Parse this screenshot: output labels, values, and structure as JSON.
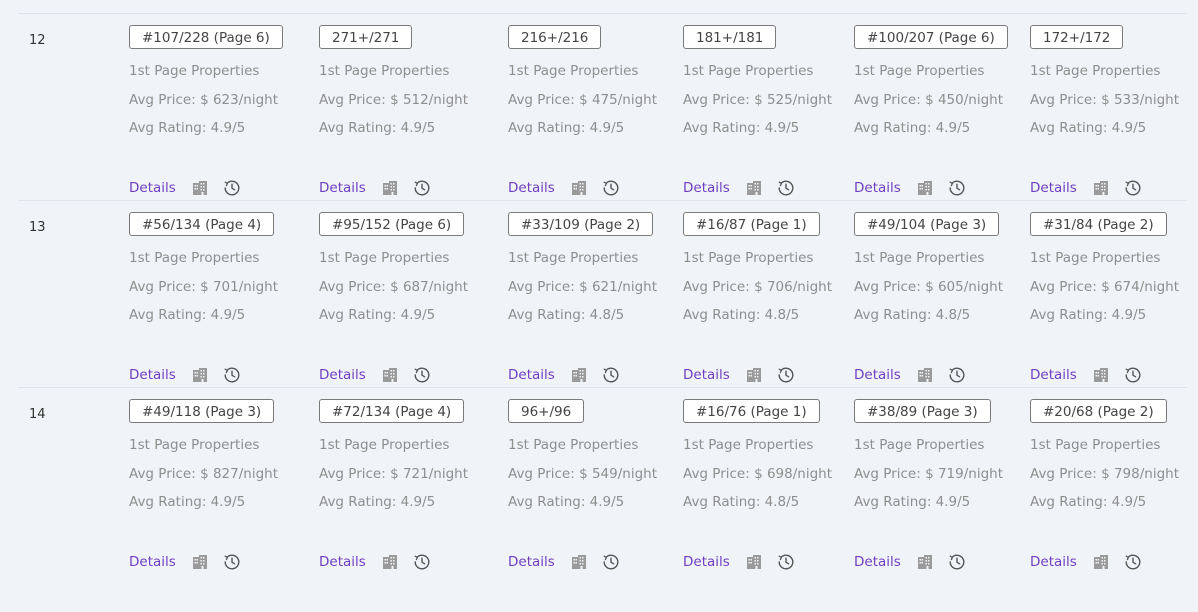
{
  "colors": {
    "link": "#6f3fc1",
    "muted": "#8e8e8e",
    "background": "#f0f4f8"
  },
  "icons": {
    "building": "building-icon",
    "history": "history-icon"
  },
  "rows": [
    {
      "number": "12",
      "cells": [
        {
          "rank": "#107/228 (Page 6)",
          "label": "1st Page Properties",
          "price": "Avg Price: $ 623/night",
          "rating": "Avg Rating: 4.9/5",
          "details": "Details"
        },
        {
          "rank": "271+/271",
          "label": "1st Page Properties",
          "price": "Avg Price: $ 512/night",
          "rating": "Avg Rating: 4.9/5",
          "details": "Details"
        },
        {
          "rank": "216+/216",
          "label": "1st Page Properties",
          "price": "Avg Price: $ 475/night",
          "rating": "Avg Rating: 4.9/5",
          "details": "Details"
        },
        {
          "rank": "181+/181",
          "label": "1st Page Properties",
          "price": "Avg Price: $ 525/night",
          "rating": "Avg Rating: 4.9/5",
          "details": "Details"
        },
        {
          "rank": "#100/207 (Page 6)",
          "label": "1st Page Properties",
          "price": "Avg Price: $ 450/night",
          "rating": "Avg Rating: 4.9/5",
          "details": "Details"
        },
        {
          "rank": "172+/172",
          "label": "1st Page Properties",
          "price": "Avg Price: $ 533/night",
          "rating": "Avg Rating: 4.9/5",
          "details": "Details"
        }
      ]
    },
    {
      "number": "13",
      "cells": [
        {
          "rank": "#56/134 (Page 4)",
          "label": "1st Page Properties",
          "price": "Avg Price: $ 701/night",
          "rating": "Avg Rating: 4.9/5",
          "details": "Details"
        },
        {
          "rank": "#95/152 (Page 6)",
          "label": "1st Page Properties",
          "price": "Avg Price: $ 687/night",
          "rating": "Avg Rating: 4.9/5",
          "details": "Details"
        },
        {
          "rank": "#33/109 (Page 2)",
          "label": "1st Page Properties",
          "price": "Avg Price: $ 621/night",
          "rating": "Avg Rating: 4.8/5",
          "details": "Details"
        },
        {
          "rank": "#16/87 (Page 1)",
          "label": "1st Page Properties",
          "price": "Avg Price: $ 706/night",
          "rating": "Avg Rating: 4.8/5",
          "details": "Details"
        },
        {
          "rank": "#49/104 (Page 3)",
          "label": "1st Page Properties",
          "price": "Avg Price: $ 605/night",
          "rating": "Avg Rating: 4.8/5",
          "details": "Details"
        },
        {
          "rank": "#31/84 (Page 2)",
          "label": "1st Page Properties",
          "price": "Avg Price: $ 674/night",
          "rating": "Avg Rating: 4.9/5",
          "details": "Details"
        }
      ]
    },
    {
      "number": "14",
      "cells": [
        {
          "rank": "#49/118 (Page 3)",
          "label": "1st Page Properties",
          "price": "Avg Price: $ 827/night",
          "rating": "Avg Rating: 4.9/5",
          "details": "Details"
        },
        {
          "rank": "#72/134 (Page 4)",
          "label": "1st Page Properties",
          "price": "Avg Price: $ 721/night",
          "rating": "Avg Rating: 4.9/5",
          "details": "Details"
        },
        {
          "rank": "96+/96",
          "label": "1st Page Properties",
          "price": "Avg Price: $ 549/night",
          "rating": "Avg Rating: 4.9/5",
          "details": "Details"
        },
        {
          "rank": "#16/76 (Page 1)",
          "label": "1st Page Properties",
          "price": "Avg Price: $ 698/night",
          "rating": "Avg Rating: 4.8/5",
          "details": "Details"
        },
        {
          "rank": "#38/89 (Page 3)",
          "label": "1st Page Properties",
          "price": "Avg Price: $ 719/night",
          "rating": "Avg Rating: 4.9/5",
          "details": "Details"
        },
        {
          "rank": "#20/68 (Page 2)",
          "label": "1st Page Properties",
          "price": "Avg Price: $ 798/night",
          "rating": "Avg Rating: 4.9/5",
          "details": "Details"
        }
      ]
    }
  ]
}
